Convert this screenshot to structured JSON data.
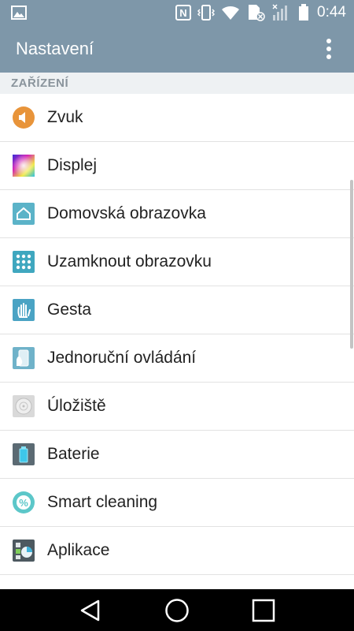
{
  "status_bar": {
    "time": "0:44",
    "icons": [
      "image-notification-icon",
      "nfc-icon",
      "vibrate-icon",
      "wifi-icon",
      "no-sim-icon",
      "signal-icon",
      "battery-icon"
    ]
  },
  "app_bar": {
    "title": "Nastavení",
    "overflow_icon": "more-vert-icon"
  },
  "section": {
    "header": "ZAŘÍZENÍ"
  },
  "items": [
    {
      "label": "Zvuk",
      "icon": "speaker-icon"
    },
    {
      "label": "Displej",
      "icon": "display-icon"
    },
    {
      "label": "Domovská obrazovka",
      "icon": "home-screen-icon"
    },
    {
      "label": "Uzamknout obrazovku",
      "icon": "lock-screen-icon"
    },
    {
      "label": "Gesta",
      "icon": "gesture-icon"
    },
    {
      "label": "Jednoruční ovládání",
      "icon": "one-hand-icon"
    },
    {
      "label": "Úložiště",
      "icon": "storage-icon"
    },
    {
      "label": "Baterie",
      "icon": "battery-settings-icon"
    },
    {
      "label": "Smart cleaning",
      "icon": "smart-cleaning-icon"
    },
    {
      "label": "Aplikace",
      "icon": "apps-icon"
    }
  ],
  "nav_bar": {
    "icons": [
      "back-icon",
      "home-icon",
      "recents-icon"
    ]
  },
  "colors": {
    "header_bg": "#7e97a9",
    "section_bg": "#eef1f3",
    "section_text": "#8a949c",
    "nav_bg": "#000000"
  }
}
